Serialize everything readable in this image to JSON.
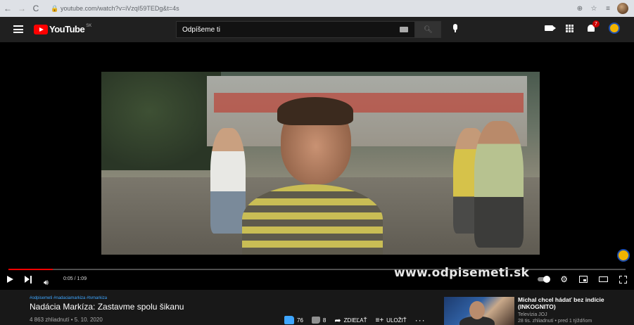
{
  "browser": {
    "url": "youtube.com/watch?v=iVzqI59TEDg&t=4s"
  },
  "header": {
    "logo_text": "YouTube",
    "logo_region": "SK",
    "search_value": "Odpíšeme ti",
    "notification_count": "7"
  },
  "player": {
    "current_time": "0:05",
    "duration": "1:09",
    "time_display": "0:05 / 1:09",
    "progress_fraction": 0.072,
    "watermark": "www.odpisemeti.sk"
  },
  "video": {
    "hashtags": "#odpisemeti #nadaciamarkiza #tvmarkiza",
    "title": "Nadácia Markíza: Zastavme spolu šikanu",
    "meta": "4 863 zhliadnutí • 5. 10. 2020",
    "likes": "76",
    "dislikes": "8",
    "share_label": "ZDIEĽAŤ",
    "save_label": "ULOŽIŤ"
  },
  "recommendation": {
    "title": "Michal chcel hádať bez indície (INKOGNITO)",
    "channel": "Televízia JOJ",
    "meta": "28 tis. zhliadnutí • pred 1 týždňom"
  },
  "colors": {
    "accent": "#ff0000",
    "link": "#3ea6ff",
    "background": "#181818",
    "header": "#202020"
  }
}
